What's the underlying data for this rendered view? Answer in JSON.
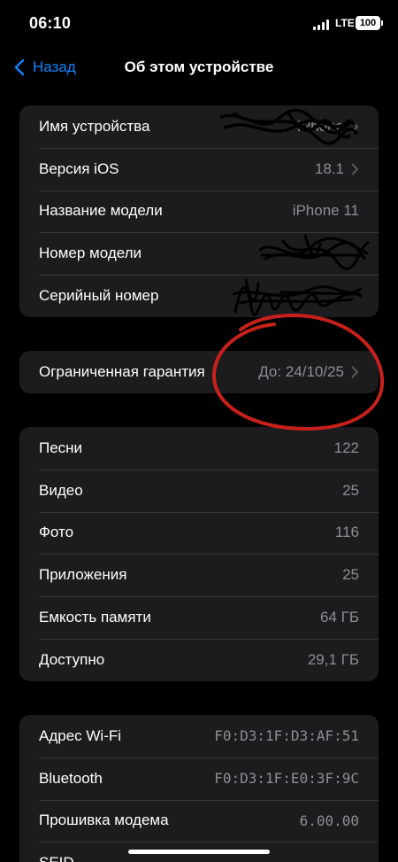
{
  "status_bar": {
    "time": "06:10",
    "network": "LTE",
    "battery": "100"
  },
  "nav": {
    "back_label": "Назад",
    "title": "Об этом устройстве"
  },
  "device_group": [
    {
      "label": "Имя устройства",
      "value": "iPhone",
      "chevron": true
    },
    {
      "label": "Версия iOS",
      "value": "18.1",
      "chevron": true
    },
    {
      "label": "Название модели",
      "value": "iPhone 11",
      "chevron": false
    },
    {
      "label": "Номер модели",
      "value": "",
      "chevron": false
    },
    {
      "label": "Серийный номер",
      "value": "",
      "chevron": false
    }
  ],
  "warranty": {
    "label": "Ограниченная гарантия",
    "value": "До: 24/10/25"
  },
  "media_group": [
    {
      "label": "Песни",
      "value": "122"
    },
    {
      "label": "Видео",
      "value": "25"
    },
    {
      "label": "Фото",
      "value": "116"
    },
    {
      "label": "Приложения",
      "value": "25"
    },
    {
      "label": "Емкость памяти",
      "value": "64 ГБ"
    },
    {
      "label": "Доступно",
      "value": "29,1 ГБ"
    }
  ],
  "network_group": [
    {
      "label": "Адрес Wi-Fi",
      "value": "F0:D3:1F:D3:AF:51"
    },
    {
      "label": "Bluetooth",
      "value": "F0:D3:1F:E0:3F:9C"
    },
    {
      "label": "Прошивка модема",
      "value": "6.00.00"
    },
    {
      "label": "SEID",
      "value": ""
    }
  ],
  "colors": {
    "accent": "#0a84ff",
    "cell_bg": "#1c1c1e",
    "secondary_text": "#8e8e93",
    "annotation": "#c8201a"
  }
}
